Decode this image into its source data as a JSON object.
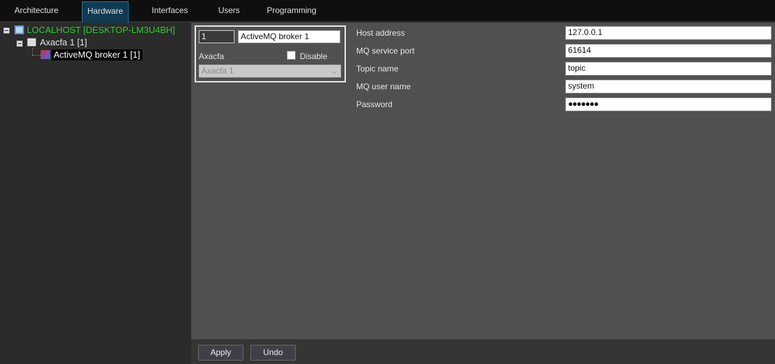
{
  "tabs": [
    "Architecture",
    "Hardware",
    "Interfaces",
    "Users",
    "Programming"
  ],
  "tree": {
    "root": "LOCALHOST [DESKTOP-LM3U4BH]",
    "child": "Axacfa 1 [1]",
    "leaf": "ActiveMQ broker 1 [1]"
  },
  "object": {
    "id": "1",
    "name": "ActiveMQ broker 1",
    "parent_label": "Axacfa",
    "disable_label": "Disable",
    "disabled": false,
    "parent_value": "Axacfa 1"
  },
  "settings": [
    {
      "label": "Host address",
      "value": "127.0.0.1"
    },
    {
      "label": "MQ service port",
      "value": "61614"
    },
    {
      "label": "Topic name",
      "value": "topic"
    },
    {
      "label": "MQ user name",
      "value": "system"
    },
    {
      "label": "Password",
      "value": "●●●●●●●"
    }
  ],
  "buttons": {
    "apply": "Apply",
    "undo": "Undo"
  }
}
